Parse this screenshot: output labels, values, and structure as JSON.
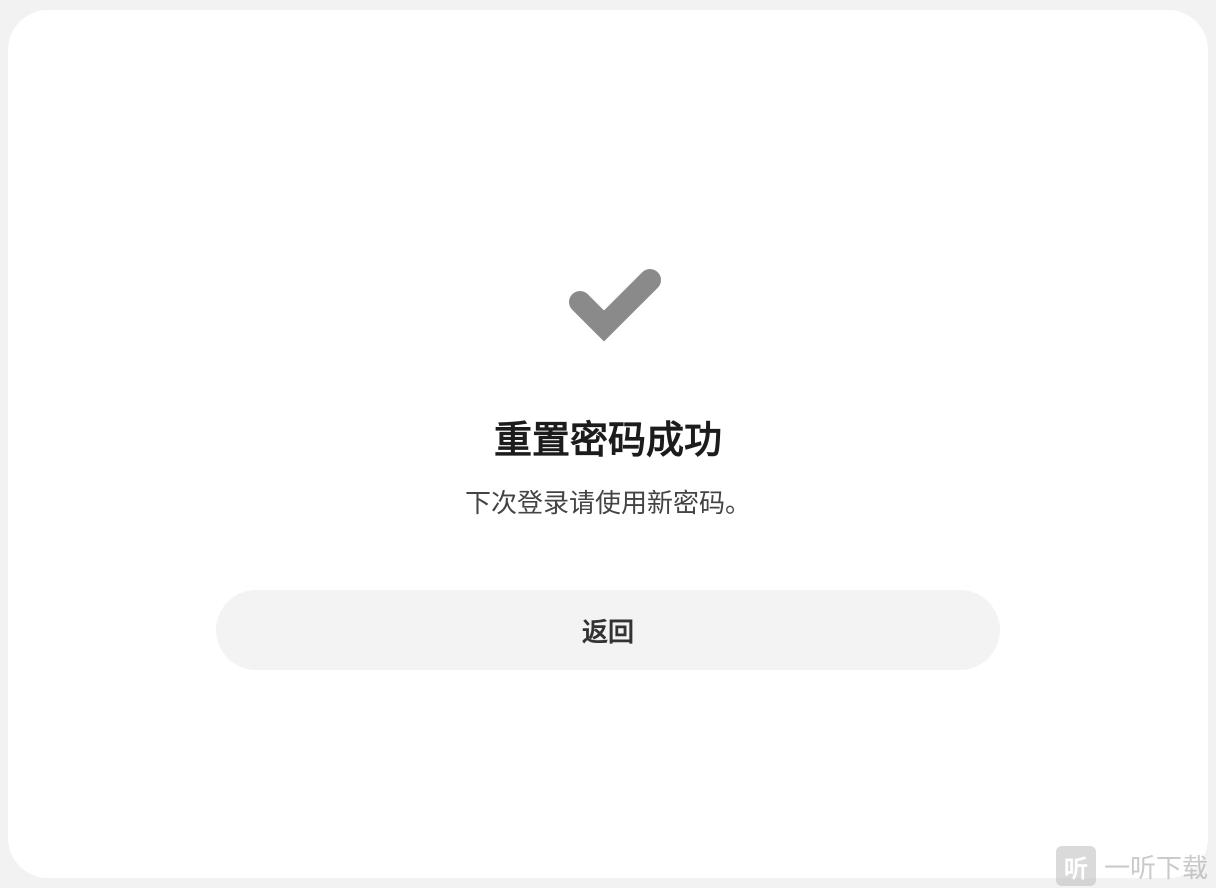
{
  "dialog": {
    "status_icon": "checkmark-icon",
    "title": "重置密码成功",
    "message": "下次登录请使用新密码。",
    "back_label": "返回"
  },
  "watermark": {
    "logo_char": "听",
    "text": "一听下载"
  },
  "colors": {
    "background": "#f2f2f2",
    "card": "#ffffff",
    "check": "#8a8a8a",
    "button_bg": "#f3f3f3",
    "title": "#1c1c1c"
  }
}
